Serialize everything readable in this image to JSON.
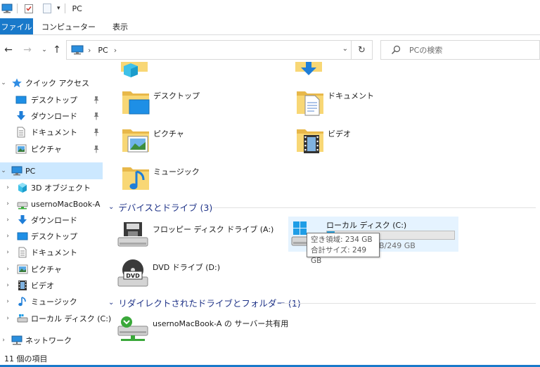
{
  "window": {
    "title": "PC"
  },
  "ribbon": {
    "tabs": [
      "ファイル",
      "コンピューター",
      "表示"
    ]
  },
  "address": {
    "location": "PC"
  },
  "search": {
    "placeholder": "PCの検索"
  },
  "sidebar": {
    "quick_access": {
      "label": "クイック アクセス",
      "items": [
        "デスクトップ",
        "ダウンロード",
        "ドキュメント",
        "ピクチャ"
      ]
    },
    "pc": {
      "label": "PC",
      "items": [
        "3D オブジェクト",
        "usernoMacBook-A",
        "ダウンロード",
        "デスクトップ",
        "ドキュメント",
        "ピクチャ",
        "ビデオ",
        "ミュージック",
        "ローカル ディスク (C:)"
      ]
    },
    "network": {
      "label": "ネットワーク"
    }
  },
  "folders": {
    "items": [
      "デスクトップ",
      "ドキュメント",
      "ピクチャ",
      "ビデオ",
      "ミュージック"
    ]
  },
  "drives": {
    "header": "デバイスとドライブ (3)",
    "floppy": "フロッピー ディスク ドライブ (A:)",
    "local_disk": {
      "name": "ローカル ディスク (C:)",
      "size_text": "B/249 GB",
      "used_fraction": 0.06
    },
    "dvd": "DVD ドライブ (D:)",
    "dvd_badge": "DVD"
  },
  "tooltip": {
    "free": "空き領域: 234 GB",
    "total": "合計サイズ: 249 GB"
  },
  "redirected": {
    "header": "リダイレクトされたドライブとフォルダー (1)",
    "share": "usernoMacBook-A の サーバー共有用"
  },
  "status": {
    "item_count": "11 個の項目"
  },
  "colors": {
    "accent": "#1979ca",
    "selection": "#cce8ff",
    "group_header": "#1e3287",
    "folder_yellow": "#f8d775",
    "drive_bar": "#26a0da"
  }
}
